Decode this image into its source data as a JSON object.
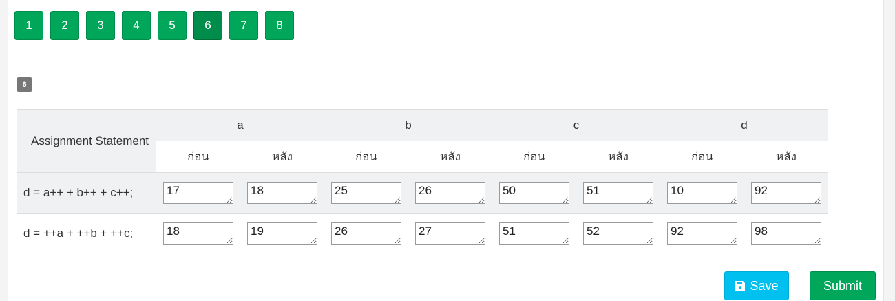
{
  "pagination": {
    "pages": [
      "1",
      "2",
      "3",
      "4",
      "5",
      "6",
      "7",
      "8"
    ],
    "active_index": 5
  },
  "question": {
    "number_badge": "6"
  },
  "table": {
    "statement_header": "Assignment Statement",
    "variables": [
      "a",
      "b",
      "c",
      "d"
    ],
    "before_label": "ก่อน",
    "after_label": "หลัง",
    "rows": [
      {
        "statement": "d = a++ + b++ + c++;",
        "values": [
          "17",
          "18",
          "25",
          "26",
          "50",
          "51",
          "10",
          "92"
        ]
      },
      {
        "statement": "d = ++a + ++b + ++c;",
        "values": [
          "18",
          "19",
          "26",
          "27",
          "51",
          "52",
          "92",
          "98"
        ]
      }
    ]
  },
  "footer": {
    "save_label": "Save",
    "save_icon": "floppy-disk-icon",
    "submit_label": "Submit"
  },
  "colors": {
    "pager_green": "#00a65a",
    "pager_active": "#008d4c",
    "save_button": "#00c0ef",
    "submit_button": "#00a65a",
    "badge": "#777777"
  }
}
